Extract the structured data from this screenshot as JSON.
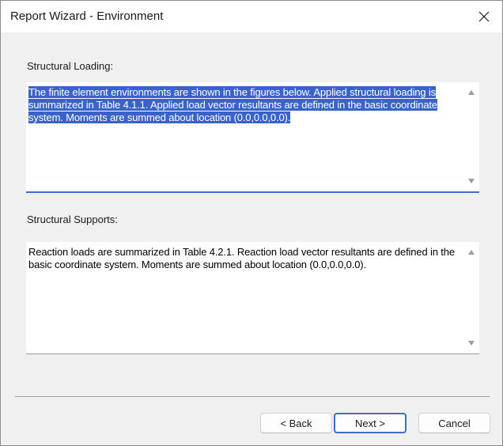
{
  "window": {
    "title": "Report Wizard - Environment"
  },
  "structural_loading": {
    "label": "Structural Loading:",
    "text": "The finite element environments are shown in the figures below. Applied structural loading is summarized in Table 4.1.1. Applied load vector resultants are defined in the basic coordinate system. Moments are summed about location (0.0,0.0,0.0)."
  },
  "structural_supports": {
    "label": "Structural Supports:",
    "text": "Reaction loads are summarized in Table 4.2.1. Reaction load vector resultants are defined in the basic coordinate system. Moments are summed about location (0.0,0.0,0.0)."
  },
  "buttons": {
    "back": "< Back",
    "next": "Next >",
    "cancel": "Cancel"
  },
  "icons": {
    "close": "close-icon",
    "scroll_up": "scroll-up-arrow-icon",
    "scroll_down": "scroll-down-arrow-icon"
  },
  "colors": {
    "selection": "#3a63c9",
    "focus_accent": "#3d6fc8",
    "dialog_background": "#f0f0f0"
  }
}
